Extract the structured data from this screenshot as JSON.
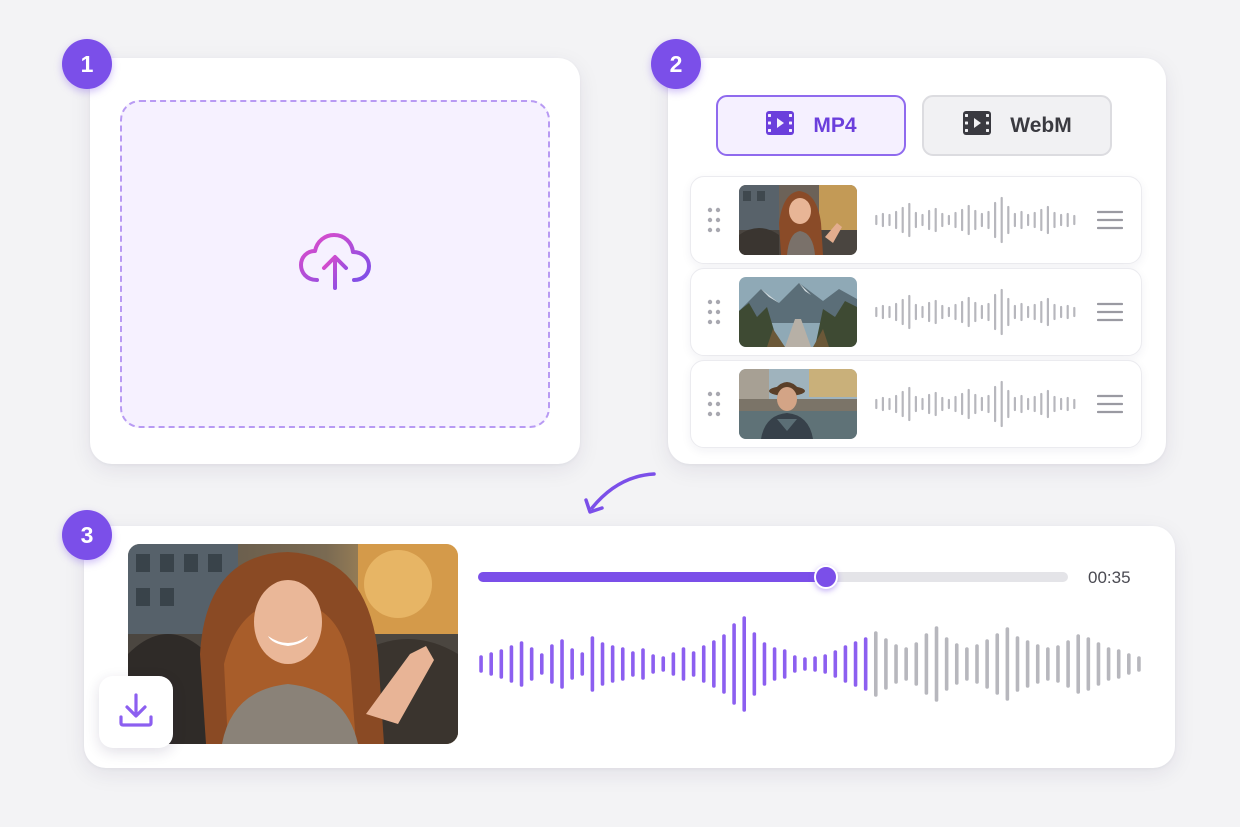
{
  "steps": {
    "step1": "1",
    "step2": "2",
    "step3": "3"
  },
  "upload": {
    "icon": "cloud-upload-icon"
  },
  "formats": {
    "options": [
      {
        "label": "MP4",
        "icon": "film-icon",
        "selected": true
      },
      {
        "label": "WebM",
        "icon": "film-icon",
        "selected": false
      }
    ]
  },
  "clips": [
    {
      "thumb": "woman-waving-thumbnail"
    },
    {
      "thumb": "mountain-road-thumbnail"
    },
    {
      "thumb": "man-canal-thumbnail"
    }
  ],
  "player": {
    "time": "00:35",
    "progress": 0.59
  },
  "colors": {
    "accent": "#7b4fe9",
    "wave_active": "#8c5ff0",
    "wave_inactive": "#b7b7bd"
  }
}
